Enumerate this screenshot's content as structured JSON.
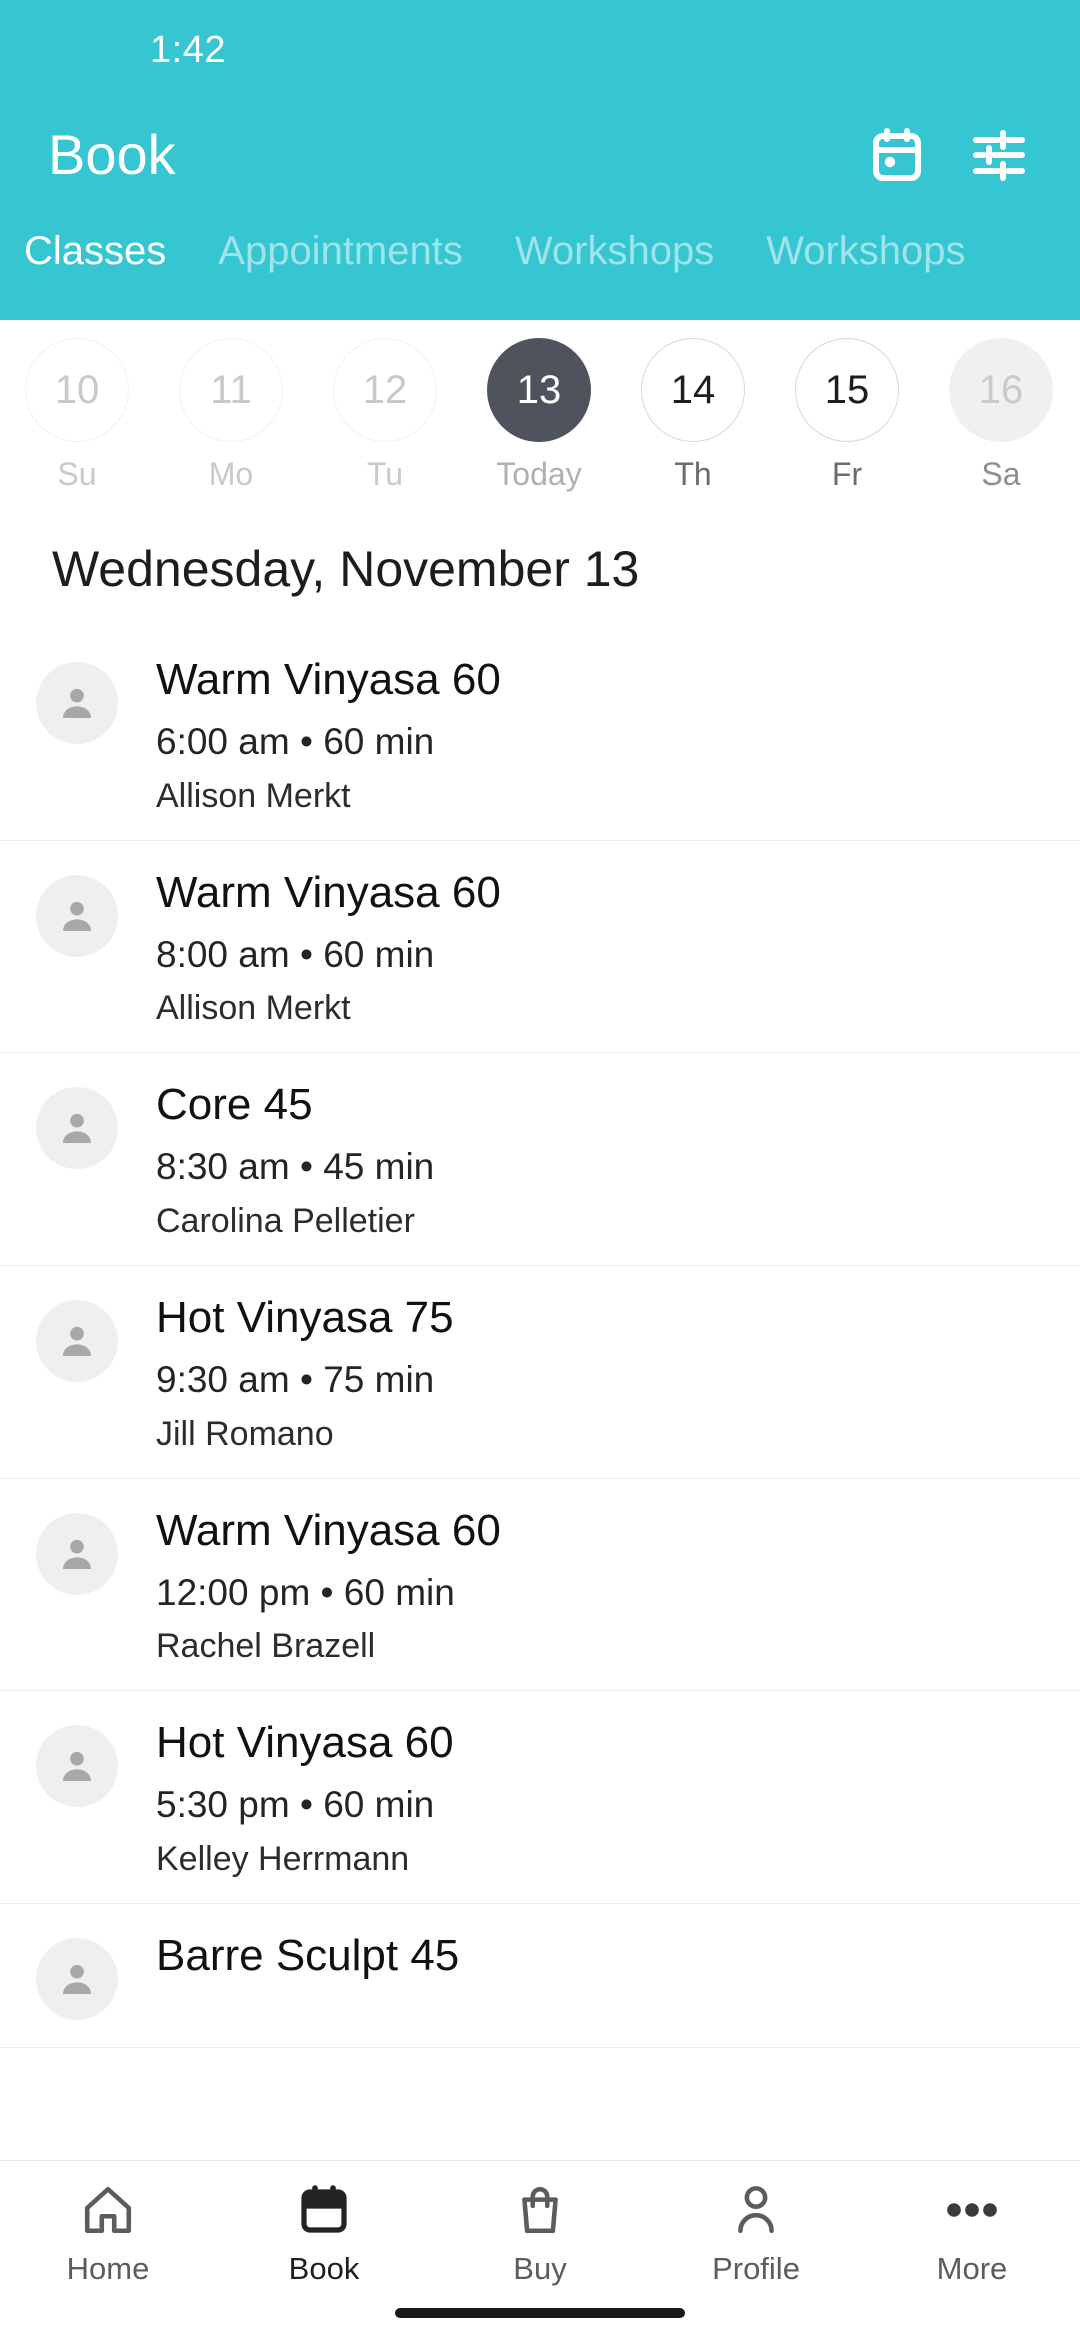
{
  "theme": {
    "brand_teal": "#35c6d2",
    "selected_day": "#4f535e",
    "text_dark": "#111111",
    "text_muted": "#c9c9c9",
    "divider": "#ececec"
  },
  "status_bar": {
    "time": "1:42"
  },
  "app_bar": {
    "title": "Book",
    "actions": [
      {
        "icon": "calendar-icon",
        "name": "calendar-button"
      },
      {
        "icon": "filter-sliders-icon",
        "name": "filter-button"
      }
    ]
  },
  "tabs": [
    {
      "label": "Classes",
      "active": true
    },
    {
      "label": "Appointments",
      "active": false
    },
    {
      "label": "Workshops",
      "active": false
    },
    {
      "label": "Workshops",
      "active": false
    }
  ],
  "date_strip": {
    "days": [
      {
        "number": "10",
        "label": "Su",
        "state": "past"
      },
      {
        "number": "11",
        "label": "Mo",
        "state": "past"
      },
      {
        "number": "12",
        "label": "Tu",
        "state": "past"
      },
      {
        "number": "13",
        "label": "Today",
        "state": "selected"
      },
      {
        "number": "14",
        "label": "Th",
        "state": "available"
      },
      {
        "number": "15",
        "label": "Fr",
        "state": "available"
      },
      {
        "number": "16",
        "label": "Sa",
        "state": "muted-fill"
      }
    ]
  },
  "date_heading": "Wednesday, November 13",
  "classes": [
    {
      "title": "Warm Vinyasa 60",
      "meta": "6:00 am • 60 min",
      "staff": "Allison Merkt"
    },
    {
      "title": "Warm Vinyasa 60",
      "meta": "8:00 am • 60 min",
      "staff": "Allison Merkt"
    },
    {
      "title": "Core 45",
      "meta": "8:30 am • 45 min",
      "staff": "Carolina Pelletier"
    },
    {
      "title": "Hot Vinyasa 75",
      "meta": "9:30 am • 75 min",
      "staff": "Jill Romano"
    },
    {
      "title": "Warm Vinyasa 60",
      "meta": "12:00 pm • 60 min",
      "staff": "Rachel Brazell"
    },
    {
      "title": "Hot Vinyasa 60",
      "meta": "5:30 pm • 60 min",
      "staff": "Kelley Herrmann"
    },
    {
      "title": "Barre Sculpt 45",
      "meta": "",
      "staff": ""
    }
  ],
  "bottom_nav": [
    {
      "label": "Home",
      "icon": "home-icon",
      "active": false
    },
    {
      "label": "Book",
      "icon": "calendar-icon",
      "active": true
    },
    {
      "label": "Buy",
      "icon": "shopping-bag-icon",
      "active": false
    },
    {
      "label": "Profile",
      "icon": "person-icon",
      "active": false
    },
    {
      "label": "More",
      "icon": "ellipsis-icon",
      "active": false
    }
  ]
}
